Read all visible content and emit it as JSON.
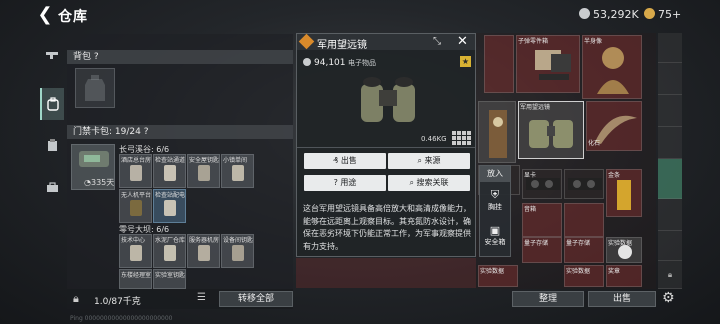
{
  "header": {
    "title": "仓库",
    "currency_primary": "53,292K",
    "currency_secondary": "75+"
  },
  "nav": {
    "items": [
      "gun-icon",
      "backpack-icon",
      "clipboard-icon",
      "toolbox-icon",
      "lock-icon"
    ]
  },
  "left_panel": {
    "backpack_label": "背包 ?",
    "keycard_label": "门禁卡包: 19/24 ?",
    "keycard_timer": "335天",
    "group1_label": "长弓溪谷: 6/6",
    "group1_slots": [
      "酒店总台房",
      "检查站通道",
      "安全屋钥匙",
      "小镇单间",
      "无人机平台",
      "检查站配电"
    ],
    "group2_label": "零号大坝: 6/6",
    "group2_slots": [
      "技术中心",
      "水泥厂仓库",
      "服务器机房",
      "设备间钥匙",
      "东楼经理室",
      "实验室钥匙"
    ]
  },
  "bottom_left": {
    "capacity": "1.0/87千克",
    "transfer_label": "转移全部"
  },
  "popup": {
    "title": "军用望远镜",
    "value": "94,101",
    "category": "电子物品",
    "weight": "0.46KG",
    "buttons": {
      "sell": "出售",
      "source": "来源",
      "usage": "用途",
      "search": "搜索关联"
    },
    "description": "这台军用望远镜具备高倍放大和高清成像能力，能够在远距离上观察目标。其充氮防水设计，确保在恶劣环境下仍能正常工作，为军事观察提供有力支持。"
  },
  "context_menu": {
    "header": "放入",
    "items": [
      "胸挂",
      "安全箱"
    ]
  },
  "warehouse": {
    "labels": [
      "子弹零件箱",
      "半身像",
      "军用望远镜",
      "化石",
      "金条",
      "显卡",
      "音箱",
      "量子存储",
      "量子存储",
      "实验数据",
      "实验数据",
      "实验数据",
      "奖章"
    ]
  },
  "bottom_right": {
    "sort_label": "整理",
    "sell_label": "出售"
  },
  "footer_text": "Ping 00000000000000000000000"
}
